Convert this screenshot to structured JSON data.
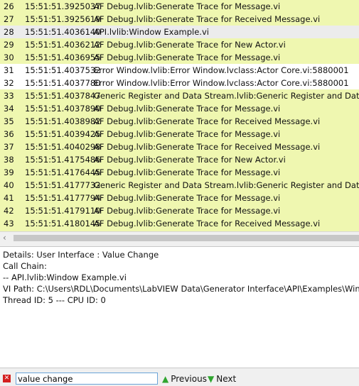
{
  "log": {
    "rows": [
      {
        "num": "26",
        "time": "15:51:51.3925037",
        "msg": "AF Debug.lvlib:Generate Trace for Message.vi",
        "style": "lime"
      },
      {
        "num": "27",
        "time": "15:51:51.3925619",
        "msg": "AF Debug.lvlib:Generate Trace for Received Message.vi",
        "style": "lime"
      },
      {
        "num": "28",
        "time": "15:51:51.4036140",
        "msg": "API.lvlib:Window Example.vi",
        "style": "grey"
      },
      {
        "num": "29",
        "time": "15:51:51.4036212",
        "msg": "AF Debug.lvlib:Generate Trace for New Actor.vi",
        "style": "lime"
      },
      {
        "num": "30",
        "time": "15:51:51.4036955",
        "msg": "AF Debug.lvlib:Generate Trace for Message.vi",
        "style": "lime"
      },
      {
        "num": "31",
        "time": "15:51:51.4037532",
        "msg": "Error Window.lvlib:Error Window.lvclass:Actor Core.vi:5880001",
        "style": "white"
      },
      {
        "num": "32",
        "time": "15:51:51.4037780",
        "msg": "Error Window.lvlib:Error Window.lvclass:Actor Core.vi:5880001",
        "style": "white"
      },
      {
        "num": "33",
        "time": "15:51:51.4037847",
        "msg": "Generic Register and Data Stream.lvlib:Generic Register and Data Stream",
        "style": "lime"
      },
      {
        "num": "34",
        "time": "15:51:51.4037890",
        "msg": "AF Debug.lvlib:Generate Trace for Message.vi",
        "style": "lime"
      },
      {
        "num": "35",
        "time": "15:51:51.4038982",
        "msg": "AF Debug.lvlib:Generate Trace for Received Message.vi",
        "style": "lime"
      },
      {
        "num": "36",
        "time": "15:51:51.4039425",
        "msg": "AF Debug.lvlib:Generate Trace for Message.vi",
        "style": "lime"
      },
      {
        "num": "37",
        "time": "15:51:51.4040298",
        "msg": "AF Debug.lvlib:Generate Trace for Received Message.vi",
        "style": "lime"
      },
      {
        "num": "38",
        "time": "15:51:51.4175486",
        "msg": "AF Debug.lvlib:Generate Trace for New Actor.vi",
        "style": "lime"
      },
      {
        "num": "39",
        "time": "15:51:51.4176445",
        "msg": "AF Debug.lvlib:Generate Trace for Message.vi",
        "style": "lime"
      },
      {
        "num": "40",
        "time": "15:51:51.4177732",
        "msg": "Generic Register and Data Stream.lvlib:Generic Register and Data Stream",
        "style": "lime"
      },
      {
        "num": "41",
        "time": "15:51:51.4177794",
        "msg": "AF Debug.lvlib:Generate Trace for Message.vi",
        "style": "lime"
      },
      {
        "num": "42",
        "time": "15:51:51.4179110",
        "msg": "AF Debug.lvlib:Generate Trace for Message.vi",
        "style": "lime"
      },
      {
        "num": "43",
        "time": "15:51:51.4180145",
        "msg": "AF Debug.lvlib:Generate Trace for Received Message.vi",
        "style": "lime"
      }
    ],
    "row_colors": {
      "lime": "#eff7b0",
      "grey": "#ececec",
      "white": "#ffffff"
    }
  },
  "scrollbar": {
    "left_arrow_icon": "chevron-left-icon"
  },
  "details": {
    "line1": "Details: User Interface : Value Change",
    "line2": "Call Chain:",
    "line3": "-- API.lvlib:Window Example.vi",
    "line4": "VI Path: C:\\Users\\RDL\\Documents\\LabVIEW Data\\Generator Interface\\API\\Examples\\Window Ex",
    "line5": "Thread ID: 5 --- CPU ID: 0"
  },
  "find": {
    "close_icon": "close-icon",
    "value": "value change",
    "previous_label": "Previous",
    "next_label": "Next",
    "previous_icon": "arrow-up-icon",
    "next_icon": "arrow-down-icon",
    "arrow_color": "#2fa52f",
    "close_color": "#d42020"
  }
}
